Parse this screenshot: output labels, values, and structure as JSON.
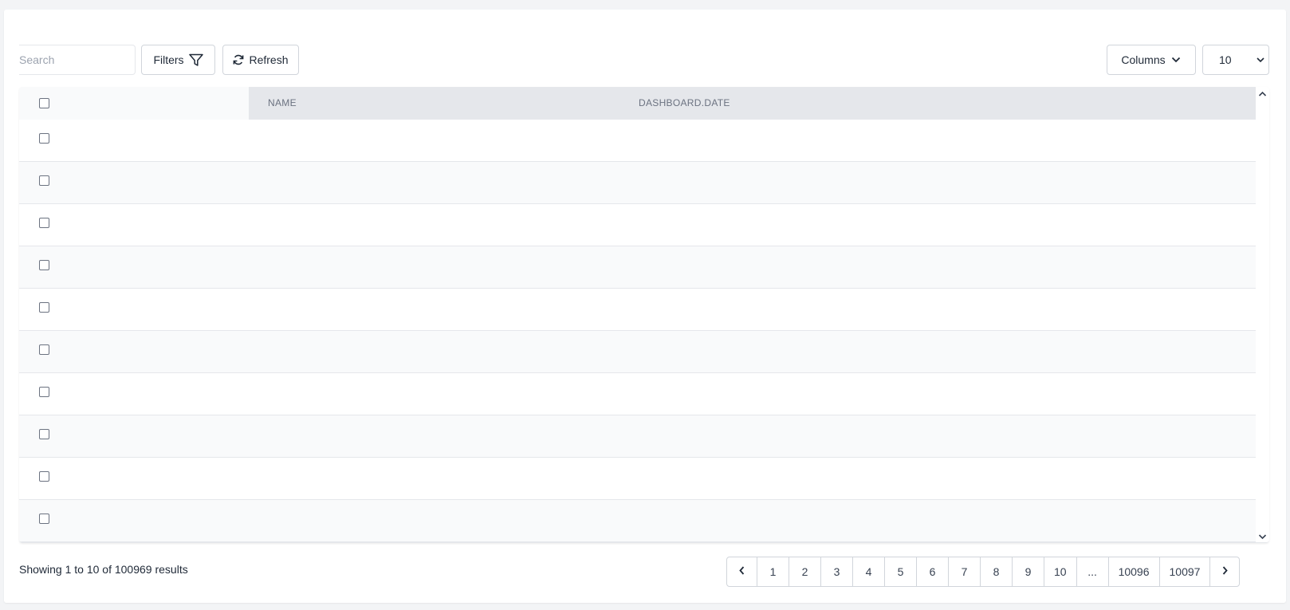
{
  "toolbar": {
    "search_placeholder": "Search",
    "filters_label": "Filters",
    "refresh_label": "Refresh",
    "columns_label": "Columns",
    "per_page_value": "10"
  },
  "table": {
    "columns": [
      "NAME",
      "DASHBOARD.DATE"
    ],
    "row_count": 10
  },
  "footer": {
    "info_parts": [
      "Showing",
      "1",
      "to",
      "10",
      "of",
      "100969",
      "results"
    ],
    "info": "Showing 1 to 10 of 100969 results"
  },
  "pagination": {
    "pages": [
      "1",
      "2",
      "3",
      "4",
      "5",
      "6",
      "7",
      "8",
      "9",
      "10",
      "...",
      "10096",
      "10097"
    ]
  }
}
